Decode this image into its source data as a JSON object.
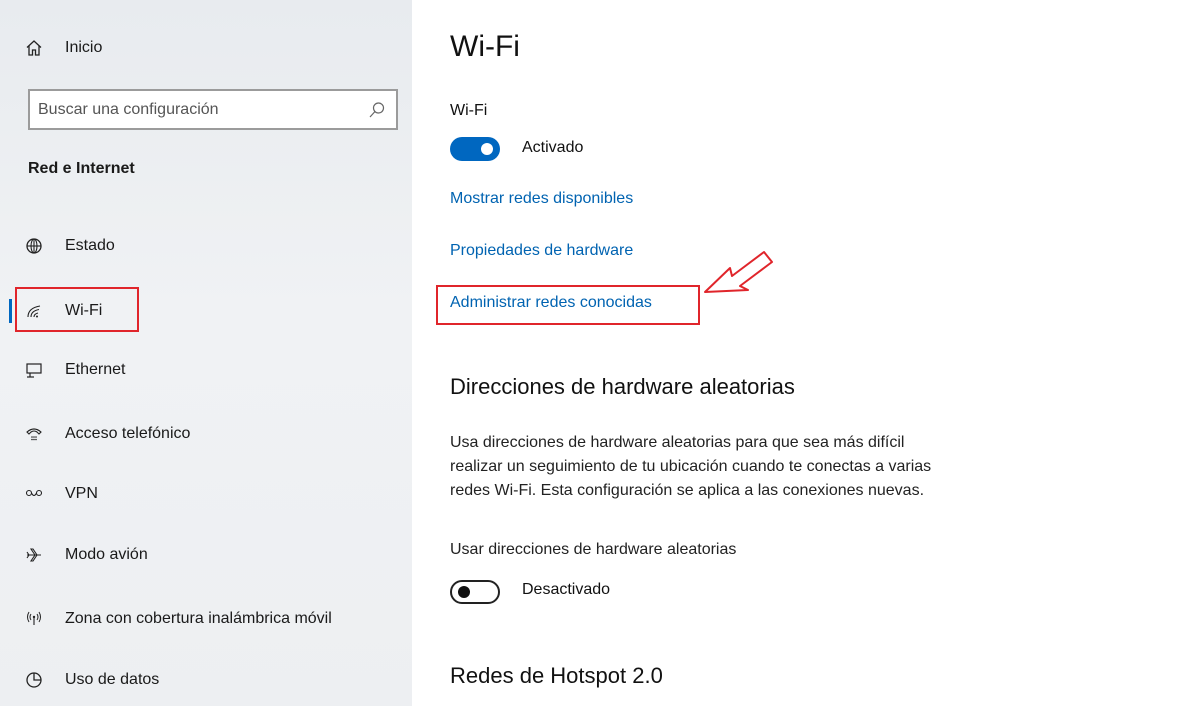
{
  "sidebar": {
    "home_label": "Inicio",
    "search_placeholder": "Buscar una configuración",
    "section_heading": "Red e Internet",
    "items": [
      {
        "label": "Estado",
        "icon": "globe-icon"
      },
      {
        "label": "Wi-Fi",
        "icon": "wifi-icon",
        "active": true
      },
      {
        "label": "Ethernet",
        "icon": "ethernet-icon"
      },
      {
        "label": "Acceso telefónico",
        "icon": "dialup-icon"
      },
      {
        "label": "VPN",
        "icon": "vpn-icon"
      },
      {
        "label": "Modo avión",
        "icon": "airplane-icon"
      },
      {
        "label": "Zona con cobertura inalámbrica móvil",
        "icon": "hotspot-icon"
      },
      {
        "label": "Uso de datos",
        "icon": "data-usage-icon"
      }
    ]
  },
  "main": {
    "title": "Wi-Fi",
    "wifi_label": "Wi-Fi",
    "wifi_toggle_state": "Activado",
    "links": {
      "show_networks": "Mostrar redes disponibles",
      "hardware_props": "Propiedades de hardware",
      "manage_known": "Administrar redes conocidas"
    },
    "random_section": {
      "title": "Direcciones de hardware aleatorias",
      "desc_line1": "Usa direcciones de hardware aleatorias para que sea más difícil",
      "desc_line2": "realizar un seguimiento de tu ubicación cuando te conectas a varias",
      "desc_line3": "redes Wi-Fi. Esta configuración se aplica a las conexiones nuevas.",
      "toggle_label": "Usar direcciones de hardware aleatorias",
      "toggle_state": "Desactivado"
    },
    "hotspot_title": "Redes de Hotspot 2.0"
  },
  "colors": {
    "accent": "#0067c0",
    "link": "#0063b1",
    "highlight": "#e0252b"
  }
}
